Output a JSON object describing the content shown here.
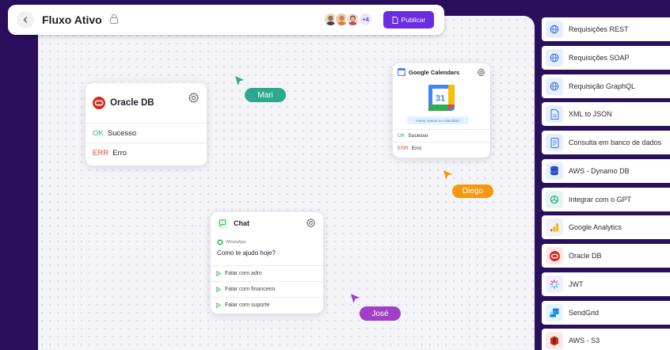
{
  "header": {
    "title": "Fluxo Ativo",
    "avatar_extra": "+4",
    "publish_label": "Publicar"
  },
  "nodes": {
    "oracle": {
      "title": "Oracle DB",
      "rows": [
        {
          "tag": "OK",
          "label": "Sucesso"
        },
        {
          "tag": "ERR",
          "label": "Erro"
        }
      ]
    },
    "gcal": {
      "title": "Google Calendars",
      "badge": "Inserir evento no calendário",
      "calendar_day": "31",
      "rows": [
        {
          "tag": "OK",
          "label": "Sucesso"
        },
        {
          "tag": "ERR",
          "label": "Erro"
        }
      ]
    },
    "chat": {
      "title": "Chat",
      "channel": "WhatsApp",
      "question": "Como te ajudo hoje?",
      "options": [
        "Falar com adm",
        "Falar com financeiro",
        "Falar com suporte"
      ]
    }
  },
  "cursors": [
    {
      "name": "Mari",
      "color": "#2aa98e"
    },
    {
      "name": "Diego",
      "color": "#f5980f"
    },
    {
      "name": "José",
      "color": "#a040c7"
    }
  ],
  "panel": {
    "items": [
      {
        "label": "Requisições REST",
        "icon": "globe-icon"
      },
      {
        "label": "Requisições SOAP",
        "icon": "globe-icon"
      },
      {
        "label": "Requisição GraphQL",
        "icon": "globe-icon"
      },
      {
        "label": "XML to JSON",
        "icon": "file-icon"
      },
      {
        "label": "Consulta em banco de dados",
        "icon": "document-icon"
      },
      {
        "label": "AWS - Dynamo DB",
        "icon": "dynamodb-icon"
      },
      {
        "label": "Integrar com o GPT",
        "icon": "openai-icon"
      },
      {
        "label": "Google Analytics",
        "icon": "analytics-icon"
      },
      {
        "label": "Oracle DB",
        "icon": "oracle-icon"
      },
      {
        "label": "JWT",
        "icon": "jwt-icon"
      },
      {
        "label": "SendGrid",
        "icon": "sendgrid-icon"
      },
      {
        "label": "AWS - S3",
        "icon": "s3-icon"
      }
    ]
  },
  "colors": {
    "background": "#2a0f5c",
    "accent": "#6b2be0",
    "ok": "#2fb757",
    "err": "#e2452f"
  }
}
